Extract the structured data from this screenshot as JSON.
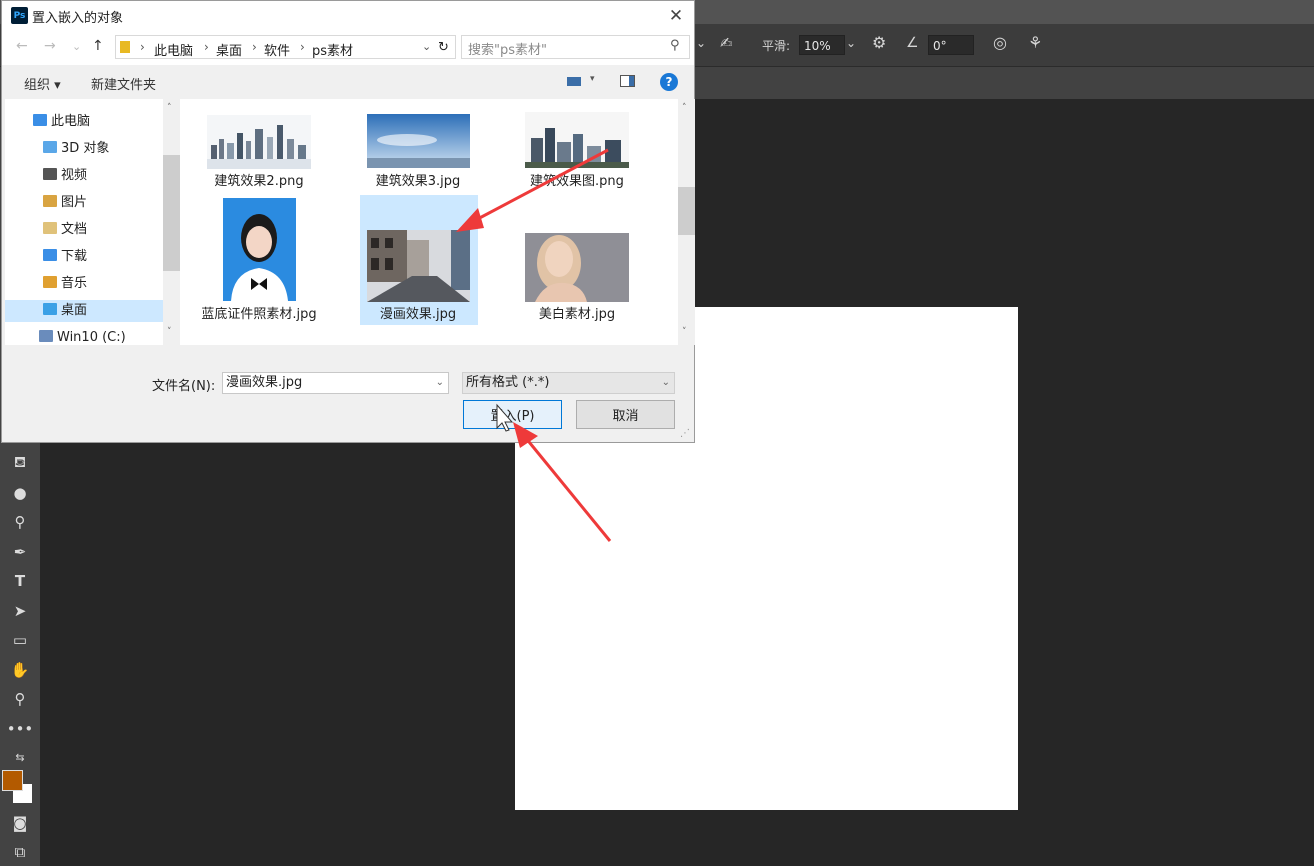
{
  "dialog": {
    "title": "置入嵌入的对象",
    "app_logo": "Ps",
    "nav": {
      "back_icon": "←",
      "forward_icon": "→",
      "recent_icon": "⌄",
      "up_icon": "↑",
      "breadcrumbs": [
        "此电脑",
        "桌面",
        "软件",
        "ps素材"
      ],
      "refresh_icon": "↻",
      "search_placeholder": "搜索\"ps素材\""
    },
    "commands": {
      "organize": "组织 ▾",
      "new_folder": "新建文件夹",
      "help": "?"
    },
    "tree": [
      {
        "label": "此电脑",
        "icon_color": "#3a8ee6"
      },
      {
        "label": "3D 对象",
        "icon_color": "#5aa7e8"
      },
      {
        "label": "视频",
        "icon_color": "#555555"
      },
      {
        "label": "图片",
        "icon_color": "#d9a441"
      },
      {
        "label": "文档",
        "icon_color": "#e0c27a"
      },
      {
        "label": "下载",
        "icon_color": "#3a8ee6"
      },
      {
        "label": "音乐",
        "icon_color": "#e0a030"
      },
      {
        "label": "桌面",
        "icon_color": "#3aa0e6"
      },
      {
        "label": "Win10 (C:)",
        "icon_color": "#6a8cbc"
      }
    ],
    "files": [
      {
        "name": "建筑效果2.png"
      },
      {
        "name": "建筑效果3.jpg"
      },
      {
        "name": "建筑效果图.png"
      },
      {
        "name": "蓝底证件照素材.jpg"
      },
      {
        "name": "漫画效果.jpg"
      },
      {
        "name": "美白素材.jpg"
      }
    ],
    "filename_label": "文件名(N):",
    "filename_value": "漫画效果.jpg",
    "filetype_value": "所有格式 (*.*)",
    "place_button": "置入(P)",
    "cancel_button": "取消"
  },
  "options_bar": {
    "smoothing_label": "平滑:",
    "smoothing_value": "10%",
    "angle_value": "0°"
  },
  "colors": {
    "foreground": "#b35a00",
    "background": "#ffffff",
    "annotation_arrow": "#ee3a3a"
  }
}
